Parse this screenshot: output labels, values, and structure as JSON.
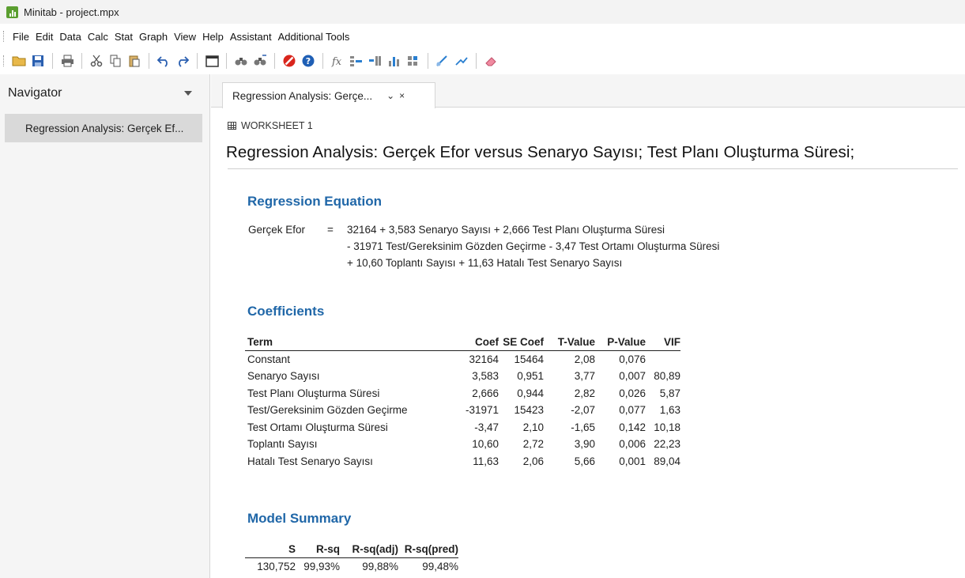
{
  "window": {
    "title": "Minitab - project.mpx"
  },
  "menu": [
    "File",
    "Edit",
    "Data",
    "Calc",
    "Stat",
    "Graph",
    "View",
    "Help",
    "Assistant",
    "Additional Tools"
  ],
  "navigator": {
    "title": "Navigator",
    "items": [
      "Regression Analysis: Gerçek Ef..."
    ]
  },
  "tab": {
    "label": "Regression Analysis: Gerçe...",
    "dropdown": "⌄",
    "close": "×"
  },
  "output": {
    "worksheet": "WORKSHEET 1",
    "heading": "Regression Analysis: Gerçek Efor versus Senaryo Sayısı; Test Planı Oluşturma Süresi;",
    "equation": {
      "title": "Regression Equation",
      "lhs": "Gerçek Efor",
      "eq": "=",
      "lines": [
        "32164 + 3,583 Senaryo Sayısı + 2,666 Test Planı Oluşturma Süresi",
        "- 31971 Test/Gereksinim Gözden Geçirme - 3,47 Test Ortamı Oluşturma Süresi",
        "+ 10,60 Toplantı Sayısı + 11,63 Hatalı Test Senaryo Sayısı"
      ]
    },
    "coefficients": {
      "title": "Coefficients",
      "columns": [
        "Term",
        "Coef",
        "SE Coef",
        "T-Value",
        "P-Value",
        "VIF"
      ],
      "rows": [
        [
          "Constant",
          "32164",
          "15464",
          "2,08",
          "0,076",
          ""
        ],
        [
          "Senaryo Sayısı",
          "3,583",
          "0,951",
          "3,77",
          "0,007",
          "80,89"
        ],
        [
          "Test Planı Oluşturma Süresi",
          "2,666",
          "0,944",
          "2,82",
          "0,026",
          "5,87"
        ],
        [
          "Test/Gereksinim Gözden Geçirme",
          "-31971",
          "15423",
          "-2,07",
          "0,077",
          "1,63"
        ],
        [
          "Test Ortamı Oluşturma Süresi",
          "-3,47",
          "2,10",
          "-1,65",
          "0,142",
          "10,18"
        ],
        [
          "Toplantı Sayısı",
          "10,60",
          "2,72",
          "3,90",
          "0,006",
          "22,23"
        ],
        [
          "Hatalı Test Senaryo Sayısı",
          "11,63",
          "2,06",
          "5,66",
          "0,001",
          "89,04"
        ]
      ]
    },
    "model_summary": {
      "title": "Model Summary",
      "columns": [
        "S",
        "R-sq",
        "R-sq(adj)",
        "R-sq(pred)"
      ],
      "rows": [
        [
          "130,752",
          "99,93%",
          "99,88%",
          "99,48%"
        ]
      ]
    }
  },
  "colors": {
    "section_title": "#2067a8",
    "app_green": "#5a9e2f"
  }
}
